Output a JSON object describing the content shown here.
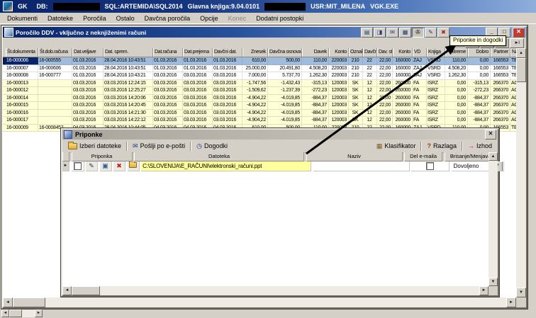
{
  "titlebar": {
    "app": "GK",
    "db": "DB:",
    "sql": "SQL:ARTEMIDA\\SQL2014",
    "version": "Glavna knjiga:9.04.0101",
    "usr": "USR:MIT_MILENA",
    "exe": "VGK.EXE"
  },
  "menu": {
    "items": [
      "Dokumenti",
      "Datoteke",
      "Poročila",
      "Ostalo",
      "Davčna poročila",
      "Opcije",
      "Konec",
      "Dodatni postopki"
    ]
  },
  "ddv": {
    "title": "Poročilo DDV - vključno z neknjiženimi računi",
    "tooltip": "Priponke in dogodki",
    "columns": [
      "Št.dokumenta",
      "Št.dob.računa",
      "Dat.veljave",
      "Dat. sprem.",
      "Dat.računa",
      "Dat.prejema",
      "Davčni dat.",
      "Znesek",
      "Davčna osnova",
      "Davek",
      "Konto",
      "Oznaka",
      "Davčna oz.",
      "Dav. st.",
      "Konto",
      "VD",
      "Knjiga",
      "Breme",
      "Dobro",
      "Partner",
      "Naziv"
    ],
    "rows": [
      {
        "selected": true,
        "tone": "white",
        "cells": [
          "16-000006",
          "16-000555",
          "01.03.2016",
          "28.04.2016 10:43:51",
          "01.03.2016",
          "01.03.2016",
          "01.03.2016",
          "610,00",
          "500,00",
          "110,00",
          "220003",
          "210",
          "22",
          "22,00",
          "160000",
          "ZAJ",
          "VSRD",
          "110,00",
          "0,00",
          "166553",
          "TE"
        ]
      },
      {
        "tone": "white",
        "cells": [
          "16-000007",
          "16-000606",
          "01.03.2016",
          "28.04.2016 10:43:51",
          "01.03.2016",
          "01.03.2016",
          "01.03.2016",
          "25.000,00",
          "20.491,80",
          "4.508,20",
          "220003",
          "210",
          "22",
          "22,00",
          "160000",
          "ZAJ",
          "VSRD",
          "4.508,20",
          "0,00",
          "166553",
          "TE"
        ]
      },
      {
        "tone": "white",
        "cells": [
          "16-000008",
          "16-000777",
          "01.03.2016",
          "28.04.2016 10:43:21",
          "03.03.2016",
          "03.03.2016",
          "03.03.2016",
          "7.000,00",
          "5.737,70",
          "1.262,30",
          "220003",
          "210",
          "22",
          "22,00",
          "160000",
          "ZAJ",
          "VSRD",
          "1.262,30",
          "0,00",
          "166553",
          "TE"
        ]
      },
      {
        "tone": "cream",
        "cells": [
          "16-000013",
          "",
          "03.03.2016",
          "03.03.2016 12:24:15",
          "03.03.2016",
          "03.03.2016",
          "03.03.2016",
          "-1.747,56",
          "-1.432,43",
          "-315,13",
          "120003",
          "SK",
          "12",
          "22,00",
          "260000",
          "FA",
          "ISRZ",
          "0,00",
          "-315,13",
          "266370",
          "ACI"
        ]
      },
      {
        "tone": "cream",
        "cells": [
          "16-000012",
          "",
          "03.03.2016",
          "03.03.2016 12:25:27",
          "03.03.2016",
          "03.03.2016",
          "03.03.2016",
          "-1.509,62",
          "-1.237,39",
          "-272,23",
          "120003",
          "SK",
          "12",
          "22,00",
          "260000",
          "FA",
          "ISRZ",
          "0,00",
          "-272,23",
          "266370",
          "ACI"
        ]
      },
      {
        "tone": "cream",
        "cells": [
          "16-000014",
          "",
          "03.03.2016",
          "03.03.2016 14:20:06",
          "03.03.2016",
          "03.03.2016",
          "03.03.2016",
          "-4.904,22",
          "-4.019,85",
          "-884,37",
          "120003",
          "SK",
          "12",
          "22,00",
          "260000",
          "FA",
          "ISRZ",
          "0,00",
          "-884,37",
          "266370",
          "ACI"
        ]
      },
      {
        "tone": "cream",
        "cells": [
          "16-000015",
          "",
          "03.03.2016",
          "03.03.2016 14:20:45",
          "03.03.2016",
          "03.03.2016",
          "03.03.2016",
          "-4.904,22",
          "-4.019,85",
          "-884,37",
          "120003",
          "SK",
          "12",
          "22,00",
          "260000",
          "FA",
          "ISRZ",
          "0,00",
          "-884,37",
          "266370",
          "ACI"
        ]
      },
      {
        "tone": "cream",
        "cells": [
          "16-000016",
          "",
          "03.03.2016",
          "03.03.2016 14:21:30",
          "03.03.2016",
          "03.03.2016",
          "03.03.2016",
          "-4.904,22",
          "-4.019,85",
          "-884,37",
          "120003",
          "SK",
          "12",
          "22,00",
          "260000",
          "FA",
          "ISRZ",
          "0,00",
          "-884,37",
          "266370",
          "ACI"
        ]
      },
      {
        "tone": "cream",
        "cells": [
          "16-000017",
          "",
          "03.03.2016",
          "03.03.2016 14:22:12",
          "03.03.2016",
          "03.03.2016",
          "03.03.2016",
          "-4.904,22",
          "-4.019,85",
          "-884,37",
          "120003",
          "SK",
          "12",
          "22,00",
          "260000",
          "FA",
          "ISRZ",
          "0,00",
          "-884,37",
          "266370",
          "ACI"
        ]
      },
      {
        "tone": "cream",
        "cells": [
          "16-000009",
          "16-0008452",
          "04.03.2016",
          "28.04.2016 10:44:05",
          "04.03.2016",
          "04.03.2016",
          "04.03.2016",
          "610,00",
          "500,00",
          "110,00",
          "220003",
          "210",
          "22",
          "22,00",
          "160000",
          "ZAJ",
          "VSRD",
          "110,00",
          "0,00",
          "166553",
          "TE"
        ]
      }
    ]
  },
  "priponke": {
    "title": "Priponke",
    "toolbar": {
      "izberi": "Izberi datoteke",
      "posta": "Pošlji po e-pošti",
      "dogodki": "Dogodki",
      "klasifikator": "Klasifikator",
      "razlaga": "Razlaga",
      "izhod": "Izhod"
    },
    "columns": [
      "Priponka",
      "Datoteka",
      "Naziv",
      "Del e-maila",
      "Brisanje/Menjava"
    ],
    "row": {
      "datoteka": "C:\\SLOVENIJA\\E_RAČUNI\\elektronski_računi.ppt",
      "naziv": "",
      "brisanje": "Dovoljeno"
    }
  },
  "icons": {
    "list": "▤",
    "copy": "◨",
    "mail": "✉",
    "grid": "▦",
    "attach": "✇",
    "edit": "✎",
    "delete": "✖",
    "min": "_",
    "max": "□",
    "close": "✕",
    "first": "I◄",
    "prev": "◄",
    "next": "►",
    "last": "►I",
    "up": "▲",
    "down": "▼",
    "left": "◄",
    "right": "►",
    "clock": "◷",
    "question": "?",
    "exit": "→",
    "disk": "▣",
    "marker": "►",
    "dropdown": "▼"
  },
  "colors": {
    "selected_row": "#9FBCDD",
    "selected_cell": "#0A246A",
    "cream_row": "#FFFFD6",
    "tooltip_bg": "#FFFFE1",
    "close_button": "#C23B2E",
    "path_cell": "#FFFF9C",
    "titlebar": "#0A246A"
  }
}
